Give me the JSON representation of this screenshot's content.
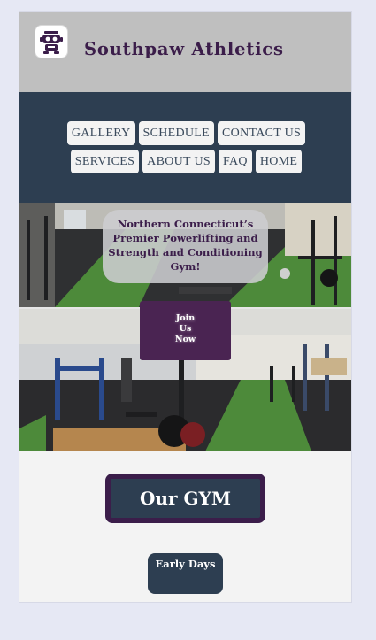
{
  "header": {
    "brand": "Southpaw Athletics",
    "logo_icon": "robot-mascot-icon"
  },
  "nav": {
    "items": [
      {
        "label": "GALLERY"
      },
      {
        "label": "SCHEDULE"
      },
      {
        "label": "CONTACT US"
      },
      {
        "label": "SERVICES"
      },
      {
        "label": "ABOUT US"
      },
      {
        "label": "FAQ"
      },
      {
        "label": "HOME"
      }
    ]
  },
  "hero": {
    "tagline": "Northern Connecticut’s Premier Powerlifting and Strength and Conditioning Gym!",
    "join": [
      "Join",
      "Us",
      "Now"
    ]
  },
  "main": {
    "our_gym": "Our GYM",
    "early_days": "Early Days"
  },
  "colors": {
    "page_bg": "#e6e8f4",
    "header_bg": "#bfbfbf",
    "nav_bg": "#2d3e51",
    "brand_purple": "#3b1d4a",
    "join_bg": "#4a2452",
    "turf_green": "#4d8a3a"
  }
}
